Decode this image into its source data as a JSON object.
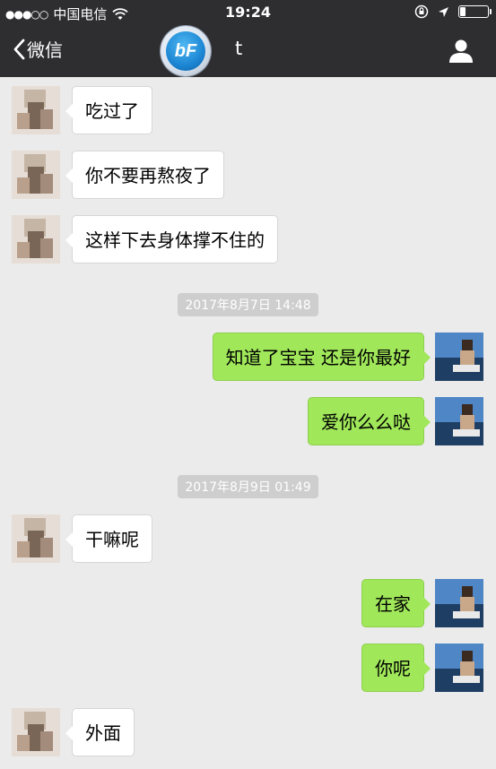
{
  "status_bar": {
    "signal_dots": "●●●○○",
    "carrier": "中国电信",
    "wifi_icon": "wifi-icon",
    "time": "19:24",
    "battery_level": 0.2
  },
  "nav": {
    "back_label": "微信",
    "logo_text": "bF",
    "title": "t"
  },
  "messages": [
    {
      "side": "left",
      "text": "吃过了"
    },
    {
      "side": "left",
      "text": "你不要再熬夜了"
    },
    {
      "side": "left",
      "text": "这样下去身体撑不住的"
    },
    {
      "timestamp": "2017年8月7日 14:48"
    },
    {
      "side": "right",
      "text": "知道了宝宝 还是你最好"
    },
    {
      "side": "right",
      "text": "爱你么么哒"
    },
    {
      "timestamp": "2017年8月9日 01:49"
    },
    {
      "side": "left",
      "text": "干嘛呢"
    },
    {
      "side": "right",
      "text": "在家"
    },
    {
      "side": "right",
      "text": "你呢"
    },
    {
      "side": "left",
      "text": "外面"
    }
  ],
  "colors": {
    "header_bg": "#2e2e31",
    "chat_bg": "#ebebeb",
    "sent_bubble": "#a0e75a",
    "received_bubble": "#ffffff"
  }
}
